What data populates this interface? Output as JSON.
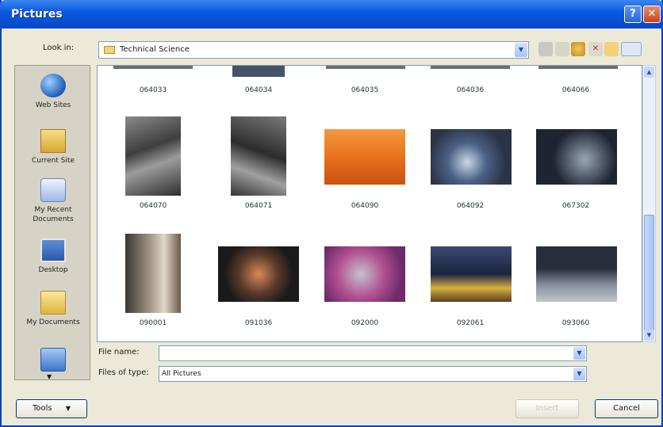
{
  "window": {
    "title": "Pictures"
  },
  "title_buttons": {
    "help": "?",
    "close": "✕"
  },
  "look_in": {
    "label": "Look in:",
    "value": "Technical Science"
  },
  "toolbar": {
    "icons": [
      "back-icon",
      "up-folder-icon",
      "search-web-icon",
      "delete-icon",
      "new-folder-icon",
      "views-icon"
    ]
  },
  "places": [
    {
      "label": "Web Sites",
      "icon": "globe-icon"
    },
    {
      "label": "Current Site",
      "icon": "current-site-icon"
    },
    {
      "label": "My Recent Documents",
      "icon": "recent-documents-icon"
    },
    {
      "label": "Desktop",
      "icon": "desktop-icon"
    },
    {
      "label": "My Documents",
      "icon": "my-documents-icon"
    },
    {
      "label": "",
      "icon": "my-computer-icon"
    }
  ],
  "files": {
    "top_row": [
      "064033",
      "064034",
      "064035",
      "064036",
      "064066"
    ],
    "middle_row": [
      "064070",
      "064071",
      "064090",
      "064092",
      "067302"
    ],
    "bottom_row": [
      "090001",
      "091036",
      "092000",
      "092061",
      "093060"
    ]
  },
  "file_name": {
    "label": "File name:",
    "value": ""
  },
  "files_of_type": {
    "label": "Files of type:",
    "value": "All Pictures"
  },
  "buttons": {
    "tools": "Tools",
    "insert": "Insert",
    "cancel": "Cancel"
  },
  "colors": {
    "titlebar": "#0a5ae0",
    "dialog_bg": "#ece9d8",
    "accent_border": "#7f9db9"
  }
}
